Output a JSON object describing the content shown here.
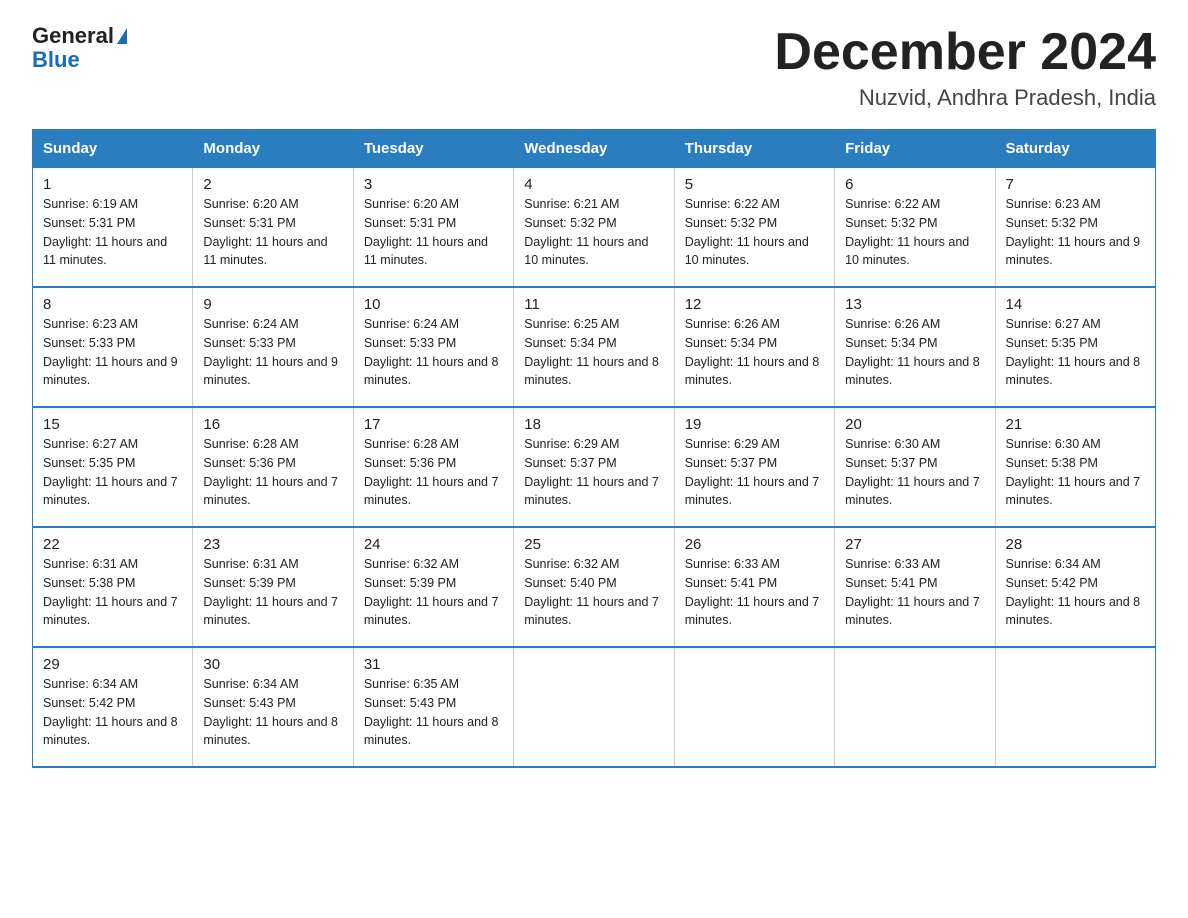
{
  "logo": {
    "general": "General",
    "blue": "Blue"
  },
  "title": "December 2024",
  "subtitle": "Nuzvid, Andhra Pradesh, India",
  "headers": [
    "Sunday",
    "Monday",
    "Tuesday",
    "Wednesday",
    "Thursday",
    "Friday",
    "Saturday"
  ],
  "weeks": [
    [
      {
        "day": "1",
        "sunrise": "Sunrise: 6:19 AM",
        "sunset": "Sunset: 5:31 PM",
        "daylight": "Daylight: 11 hours and 11 minutes."
      },
      {
        "day": "2",
        "sunrise": "Sunrise: 6:20 AM",
        "sunset": "Sunset: 5:31 PM",
        "daylight": "Daylight: 11 hours and 11 minutes."
      },
      {
        "day": "3",
        "sunrise": "Sunrise: 6:20 AM",
        "sunset": "Sunset: 5:31 PM",
        "daylight": "Daylight: 11 hours and 11 minutes."
      },
      {
        "day": "4",
        "sunrise": "Sunrise: 6:21 AM",
        "sunset": "Sunset: 5:32 PM",
        "daylight": "Daylight: 11 hours and 10 minutes."
      },
      {
        "day": "5",
        "sunrise": "Sunrise: 6:22 AM",
        "sunset": "Sunset: 5:32 PM",
        "daylight": "Daylight: 11 hours and 10 minutes."
      },
      {
        "day": "6",
        "sunrise": "Sunrise: 6:22 AM",
        "sunset": "Sunset: 5:32 PM",
        "daylight": "Daylight: 11 hours and 10 minutes."
      },
      {
        "day": "7",
        "sunrise": "Sunrise: 6:23 AM",
        "sunset": "Sunset: 5:32 PM",
        "daylight": "Daylight: 11 hours and 9 minutes."
      }
    ],
    [
      {
        "day": "8",
        "sunrise": "Sunrise: 6:23 AM",
        "sunset": "Sunset: 5:33 PM",
        "daylight": "Daylight: 11 hours and 9 minutes."
      },
      {
        "day": "9",
        "sunrise": "Sunrise: 6:24 AM",
        "sunset": "Sunset: 5:33 PM",
        "daylight": "Daylight: 11 hours and 9 minutes."
      },
      {
        "day": "10",
        "sunrise": "Sunrise: 6:24 AM",
        "sunset": "Sunset: 5:33 PM",
        "daylight": "Daylight: 11 hours and 8 minutes."
      },
      {
        "day": "11",
        "sunrise": "Sunrise: 6:25 AM",
        "sunset": "Sunset: 5:34 PM",
        "daylight": "Daylight: 11 hours and 8 minutes."
      },
      {
        "day": "12",
        "sunrise": "Sunrise: 6:26 AM",
        "sunset": "Sunset: 5:34 PM",
        "daylight": "Daylight: 11 hours and 8 minutes."
      },
      {
        "day": "13",
        "sunrise": "Sunrise: 6:26 AM",
        "sunset": "Sunset: 5:34 PM",
        "daylight": "Daylight: 11 hours and 8 minutes."
      },
      {
        "day": "14",
        "sunrise": "Sunrise: 6:27 AM",
        "sunset": "Sunset: 5:35 PM",
        "daylight": "Daylight: 11 hours and 8 minutes."
      }
    ],
    [
      {
        "day": "15",
        "sunrise": "Sunrise: 6:27 AM",
        "sunset": "Sunset: 5:35 PM",
        "daylight": "Daylight: 11 hours and 7 minutes."
      },
      {
        "day": "16",
        "sunrise": "Sunrise: 6:28 AM",
        "sunset": "Sunset: 5:36 PM",
        "daylight": "Daylight: 11 hours and 7 minutes."
      },
      {
        "day": "17",
        "sunrise": "Sunrise: 6:28 AM",
        "sunset": "Sunset: 5:36 PM",
        "daylight": "Daylight: 11 hours and 7 minutes."
      },
      {
        "day": "18",
        "sunrise": "Sunrise: 6:29 AM",
        "sunset": "Sunset: 5:37 PM",
        "daylight": "Daylight: 11 hours and 7 minutes."
      },
      {
        "day": "19",
        "sunrise": "Sunrise: 6:29 AM",
        "sunset": "Sunset: 5:37 PM",
        "daylight": "Daylight: 11 hours and 7 minutes."
      },
      {
        "day": "20",
        "sunrise": "Sunrise: 6:30 AM",
        "sunset": "Sunset: 5:37 PM",
        "daylight": "Daylight: 11 hours and 7 minutes."
      },
      {
        "day": "21",
        "sunrise": "Sunrise: 6:30 AM",
        "sunset": "Sunset: 5:38 PM",
        "daylight": "Daylight: 11 hours and 7 minutes."
      }
    ],
    [
      {
        "day": "22",
        "sunrise": "Sunrise: 6:31 AM",
        "sunset": "Sunset: 5:38 PM",
        "daylight": "Daylight: 11 hours and 7 minutes."
      },
      {
        "day": "23",
        "sunrise": "Sunrise: 6:31 AM",
        "sunset": "Sunset: 5:39 PM",
        "daylight": "Daylight: 11 hours and 7 minutes."
      },
      {
        "day": "24",
        "sunrise": "Sunrise: 6:32 AM",
        "sunset": "Sunset: 5:39 PM",
        "daylight": "Daylight: 11 hours and 7 minutes."
      },
      {
        "day": "25",
        "sunrise": "Sunrise: 6:32 AM",
        "sunset": "Sunset: 5:40 PM",
        "daylight": "Daylight: 11 hours and 7 minutes."
      },
      {
        "day": "26",
        "sunrise": "Sunrise: 6:33 AM",
        "sunset": "Sunset: 5:41 PM",
        "daylight": "Daylight: 11 hours and 7 minutes."
      },
      {
        "day": "27",
        "sunrise": "Sunrise: 6:33 AM",
        "sunset": "Sunset: 5:41 PM",
        "daylight": "Daylight: 11 hours and 7 minutes."
      },
      {
        "day": "28",
        "sunrise": "Sunrise: 6:34 AM",
        "sunset": "Sunset: 5:42 PM",
        "daylight": "Daylight: 11 hours and 8 minutes."
      }
    ],
    [
      {
        "day": "29",
        "sunrise": "Sunrise: 6:34 AM",
        "sunset": "Sunset: 5:42 PM",
        "daylight": "Daylight: 11 hours and 8 minutes."
      },
      {
        "day": "30",
        "sunrise": "Sunrise: 6:34 AM",
        "sunset": "Sunset: 5:43 PM",
        "daylight": "Daylight: 11 hours and 8 minutes."
      },
      {
        "day": "31",
        "sunrise": "Sunrise: 6:35 AM",
        "sunset": "Sunset: 5:43 PM",
        "daylight": "Daylight: 11 hours and 8 minutes."
      },
      null,
      null,
      null,
      null
    ]
  ]
}
